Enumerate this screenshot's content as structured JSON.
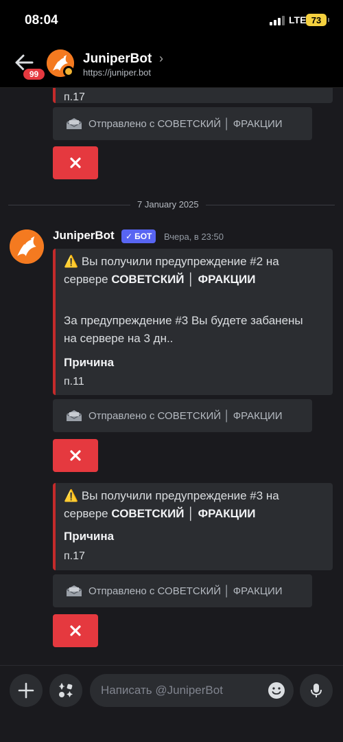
{
  "status": {
    "time": "08:04",
    "network": "LTE",
    "battery": "73"
  },
  "header": {
    "unread_badge": "99",
    "name": "JuniperBot",
    "chevron": "›",
    "url": "https://juniper.bot"
  },
  "messages": {
    "top_embed": {
      "field_value": "п.17"
    },
    "sent_from_label": "Отправлено с СОВЕТСКИЙ │ ФРАКЦИИ",
    "date_divider": "7 January 2025",
    "author": "JuniperBot",
    "bot_tag": "БОТ",
    "timestamp": "Вчера, в 23:50",
    "embed1": {
      "warning_emoji": "⚠️",
      "line1_prefix": "Вы получили предупреждение #2 на",
      "line2_prefix": "сервере",
      "server_name": "СОВЕТСКИЙ │ ФРАКЦИИ",
      "desc_line1": "За предупреждение #3 Вы будете забанены",
      "desc_line2": "на сервере на 3 дн..",
      "field_name": "Причина",
      "field_value": "п.11"
    },
    "embed2": {
      "warning_emoji": "⚠️",
      "line1_prefix": "Вы получили предупреждение #3 на",
      "line2_prefix": "сервере",
      "server_name": "СОВЕТСКИЙ │ ФРАКЦИИ",
      "field_name": "Причина",
      "field_value": "п.17"
    }
  },
  "composer": {
    "placeholder": "Написать @JuniperBot"
  },
  "icons": {
    "back": "arrow-left-icon",
    "avatar": "juniperbot-fox-avatar",
    "mail": "envelope-icon",
    "dismiss": "close-icon",
    "add": "plus-icon",
    "apps": "apps-icon",
    "emoji": "emoji-icon",
    "mic": "microphone-icon"
  },
  "colors": {
    "accent_red": "#e5393f",
    "embed_border": "#c42b2b",
    "bot_tag": "#5865f2",
    "background": "#1a1a1e",
    "surface": "#2b2d31",
    "status_idle": "#f0b232"
  }
}
